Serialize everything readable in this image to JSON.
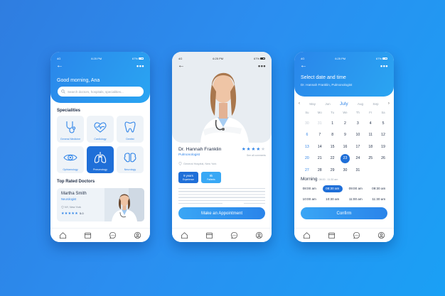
{
  "status": {
    "signal": "4G",
    "time": "6:25 PM",
    "battery": "67%"
  },
  "screen1": {
    "greeting": "Good morning, Ana",
    "search_placeholder": "Search doctors, hospitals, specialities...",
    "specialities_title": "Specialities",
    "specialities": [
      "General Medicine",
      "Cardiology",
      "Dentist",
      "Ophtamology",
      "Pneumology",
      "Neurology"
    ],
    "active_speciality": "Pneumology",
    "top_rated_title": "Top Rated Doctors",
    "doctor": {
      "name": "Martha Smith",
      "speciality": "Neurologist",
      "location": "NY, New York",
      "stars": "★★★★★",
      "rating": "5.0"
    }
  },
  "screen2": {
    "name": "Dr. Hannah Franklin",
    "speciality": "Pulmonologist",
    "stars": "★★★★",
    "stars_empty": "★",
    "comments": "See all comments",
    "location": "General Hospital, New York",
    "experience_value": "9 years",
    "experience_label": "Experience",
    "patients_value": "8k",
    "patients_label": "Patients",
    "button": "Make an Appointment"
  },
  "screen3": {
    "title": "Select date and time",
    "subtitle": "Dr. Hannah Franklin, Pulmonologist",
    "months": [
      "May",
      "Jun",
      "July",
      "Aug",
      "Sep"
    ],
    "current_month": "July",
    "days_of_week": [
      "Su",
      "Mo",
      "Tu",
      "We",
      "Th",
      "Fr",
      "Sa"
    ],
    "calendar_rows": [
      [
        "30",
        "31",
        "1",
        "2",
        "3",
        "4",
        "5"
      ],
      [
        "6",
        "7",
        "8",
        "9",
        "10",
        "11",
        "12"
      ],
      [
        "13",
        "14",
        "15",
        "16",
        "17",
        "18",
        "19"
      ],
      [
        "20",
        "21",
        "22",
        "23",
        "24",
        "25",
        "26"
      ],
      [
        "27",
        "28",
        "29",
        "30",
        "31",
        "",
        ""
      ]
    ],
    "selected_day": "23",
    "morning_title": "Morning",
    "morning_range": "08:00 - 11:30 am",
    "times": [
      "08:00 am",
      "08:30 am",
      "09:00 am",
      "09:30 am",
      "10:00 am",
      "10:30 am",
      "11:00 am",
      "11:30 am"
    ],
    "selected_time": "08:30 am",
    "button": "Confirm"
  },
  "colors": {
    "primary": "#2f84e8",
    "accent_dark": "#1f6fd8",
    "text_dark": "#25324a",
    "background": "#2b8ef0"
  }
}
